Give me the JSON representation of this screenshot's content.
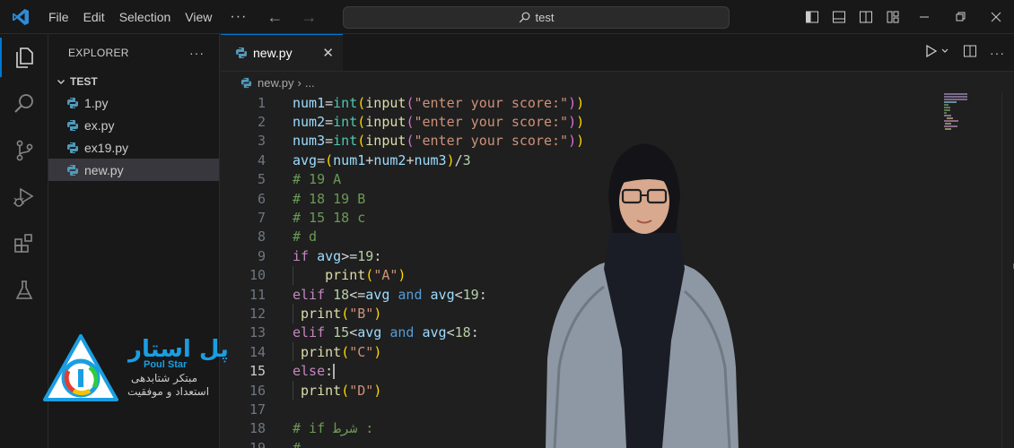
{
  "window": {
    "menu": [
      "File",
      "Edit",
      "Selection",
      "View"
    ],
    "search_text": "test"
  },
  "sidebar": {
    "title": "EXPLORER",
    "folder": "TEST",
    "files": [
      "1.py",
      "ex.py",
      "ex19.py",
      "new.py"
    ],
    "selected_file": "new.py"
  },
  "editor": {
    "tab_label": "new.py",
    "breadcrumb_file": "new.py",
    "breadcrumb_more": "...",
    "current_line": 15,
    "line_numbers": [
      "1",
      "2",
      "3",
      "4",
      "5",
      "6",
      "7",
      "8",
      "9",
      "10",
      "11",
      "12",
      "13",
      "14",
      "15",
      "16",
      "17",
      "18",
      "19"
    ]
  },
  "code_lines": [
    "num1=int(input(\"enter your score:\"))",
    "num2=int(input(\"enter your score:\"))",
    "num3=int(input(\"enter your score:\"))",
    "avg=(num1+num2+num3)/3",
    "# 19 A",
    "# 18 19 B",
    "# 15 18 c",
    "# d",
    "if avg>=19:",
    "    print(\"A\")",
    "elif 18<=avg and avg<19:",
    " print(\"B\")",
    "elif 15<avg and avg<18:",
    " print(\"C\")",
    "else:",
    " print(\"D\")",
    "",
    "# if شرط :",
    "#"
  ],
  "badge": {
    "title_fa": "پل استار",
    "title_en": "Poul Star",
    "sub1": "مبتکر شتابدهی",
    "sub2": "استعداد و موفقیت"
  },
  "colors": {
    "accent": "#0078d4",
    "badge_blue": "#1a9ee2"
  }
}
